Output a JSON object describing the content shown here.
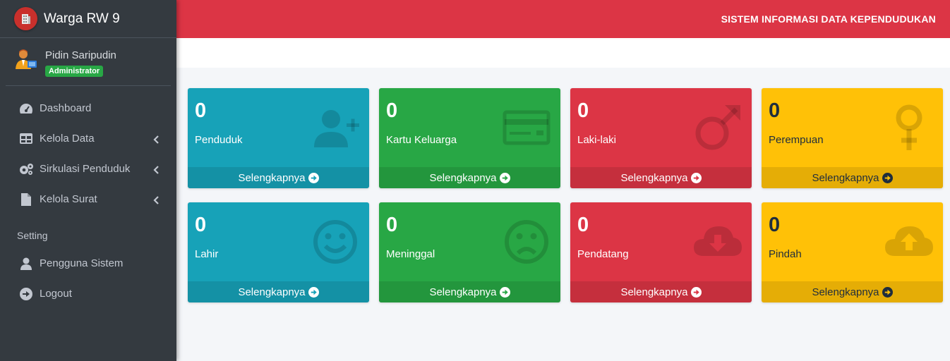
{
  "brand": {
    "title": "Warga RW 9"
  },
  "user": {
    "name": "Pidin Saripudin",
    "role": "Administrator"
  },
  "nav": {
    "items": [
      {
        "label": "Dashboard",
        "icon": "tachometer-icon"
      },
      {
        "label": "Kelola Data",
        "icon": "table-icon"
      },
      {
        "label": "Sirkulasi Penduduk",
        "icon": "cogs-icon"
      },
      {
        "label": "Kelola Surat",
        "icon": "file-icon"
      }
    ],
    "header": "Setting",
    "setting_items": [
      {
        "label": "Pengguna Sistem",
        "icon": "user-icon"
      },
      {
        "label": "Logout",
        "icon": "arrow-circle-right-icon"
      }
    ]
  },
  "topbar": {
    "title": "SISTEM INFORMASI DATA KEPENDUDUKAN"
  },
  "cards": [
    {
      "count": "0",
      "label": "Penduduk",
      "footer": "Selengkapnya",
      "color": "#17a2b8",
      "icon": "user-plus-icon"
    },
    {
      "count": "0",
      "label": "Kartu Keluarga",
      "footer": "Selengkapnya",
      "color": "#28a745",
      "icon": "credit-card-icon"
    },
    {
      "count": "0",
      "label": "Laki-laki",
      "footer": "Selengkapnya",
      "color": "#dc3545",
      "icon": "mars-icon"
    },
    {
      "count": "0",
      "label": "Perempuan",
      "footer": "Selengkapnya",
      "color": "#ffc107",
      "icon": "venus-icon"
    },
    {
      "count": "0",
      "label": "Lahir",
      "footer": "Selengkapnya",
      "color": "#17a2b8",
      "icon": "smile-icon"
    },
    {
      "count": "0",
      "label": "Meninggal",
      "footer": "Selengkapnya",
      "color": "#28a745",
      "icon": "frown-icon"
    },
    {
      "count": "0",
      "label": "Pendatang",
      "footer": "Selengkapnya",
      "color": "#dc3545",
      "icon": "cloud-download-icon"
    },
    {
      "count": "0",
      "label": "Pindah",
      "footer": "Selengkapnya",
      "color": "#ffc107",
      "icon": "cloud-upload-icon"
    }
  ]
}
